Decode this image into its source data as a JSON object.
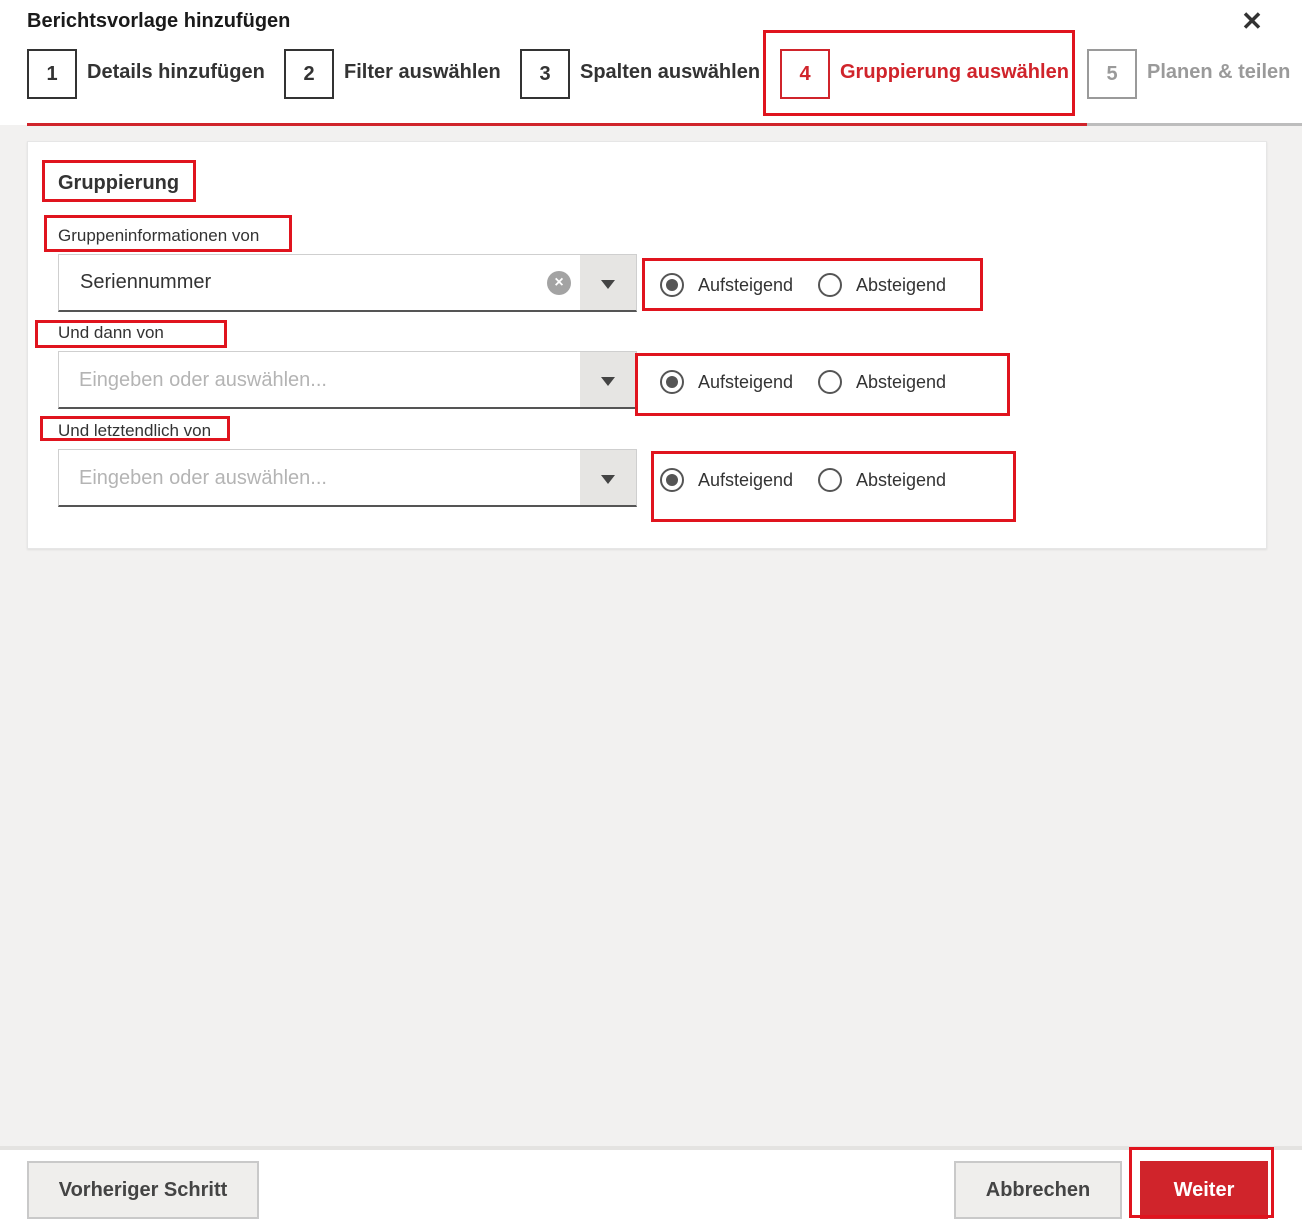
{
  "dialog": {
    "title": "Berichtsvorlage hinzufügen",
    "close_icon": "close-icon",
    "close_glyph": "✕"
  },
  "steps": [
    {
      "number": "1",
      "label": "Details hinzufügen",
      "state": "done"
    },
    {
      "number": "2",
      "label": "Filter auswählen",
      "state": "done"
    },
    {
      "number": "3",
      "label": "Spalten auswählen",
      "state": "done"
    },
    {
      "number": "4",
      "label": "Gruppierung auswählen",
      "state": "active"
    },
    {
      "number": "5",
      "label": "Planen & teilen",
      "state": "future"
    }
  ],
  "grouping": {
    "title": "Gruppierung",
    "fields": [
      {
        "label": "Gruppeninformationen von",
        "value": "Seriennummer",
        "placeholder": "",
        "sort_options": [
          "Aufsteigend",
          "Absteigend"
        ],
        "selected_sort": "Aufsteigend"
      },
      {
        "label": "Und dann von",
        "value": "",
        "placeholder": "Eingeben oder auswählen...",
        "sort_options": [
          "Aufsteigend",
          "Absteigend"
        ],
        "selected_sort": "Aufsteigend"
      },
      {
        "label": "Und letztendlich von",
        "value": "",
        "placeholder": "Eingeben oder auswählen...",
        "sort_options": [
          "Aufsteigend",
          "Absteigend"
        ],
        "selected_sort": "Aufsteigend"
      }
    ]
  },
  "footer": {
    "back_label": "Vorheriger Schritt",
    "cancel_label": "Abbrechen",
    "next_label": "Weiter"
  },
  "colors": {
    "accent": "#d0242b",
    "highlight": "#e0141e",
    "background": "#f2f1f0"
  }
}
